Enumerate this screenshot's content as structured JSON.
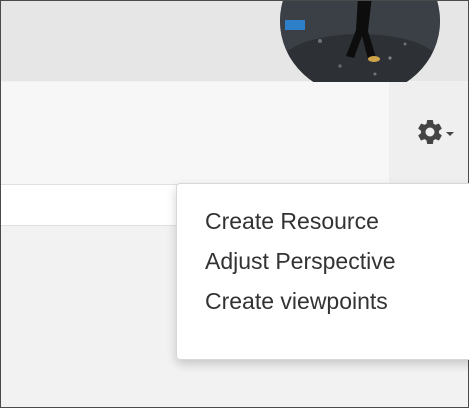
{
  "toolbar": {
    "settings_icon": "gear-icon",
    "dropdown_indicator": "caret-down-icon"
  },
  "menu": {
    "items": [
      {
        "label": "Create Resource"
      },
      {
        "label": "Adjust Perspective"
      },
      {
        "label": "Create viewpoints"
      }
    ]
  },
  "colors": {
    "menu_text": "#333333",
    "icon": "#444444",
    "top_bar": "#e6e6e6"
  }
}
